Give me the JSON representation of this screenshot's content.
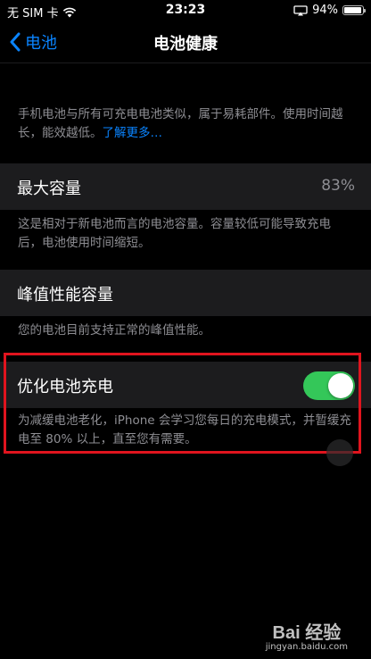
{
  "status_bar": {
    "carrier": "无 SIM 卡",
    "time": "23:23",
    "battery_percent": "94%",
    "battery_level": 0.94
  },
  "nav": {
    "back_label": "电池",
    "title": "电池健康"
  },
  "intro": {
    "text": "手机电池与所有可充电电池类似，属于易耗部件。使用时间越长，能效越低。",
    "link": "了解更多…"
  },
  "max_capacity": {
    "label": "最大容量",
    "value": "83%",
    "footer": "这是相对于新电池而言的电池容量。容量较低可能导致充电后，电池使用时间缩短。"
  },
  "peak_performance": {
    "label": "峰值性能容量",
    "footer": "您的电池目前支持正常的峰值性能。"
  },
  "optimized_charging": {
    "label": "优化电池充电",
    "enabled": true,
    "footer": "为减缓电池老化，iPhone 会学习您每日的充电模式，并暂缓充电至 80% 以上，直至您有需要。"
  },
  "watermark": {
    "logo": "Bai 经验",
    "url": "jingyan.baidu.com"
  },
  "colors": {
    "accent": "#0a84ff",
    "toggle_on": "#34c759",
    "highlight": "#e0141e"
  }
}
